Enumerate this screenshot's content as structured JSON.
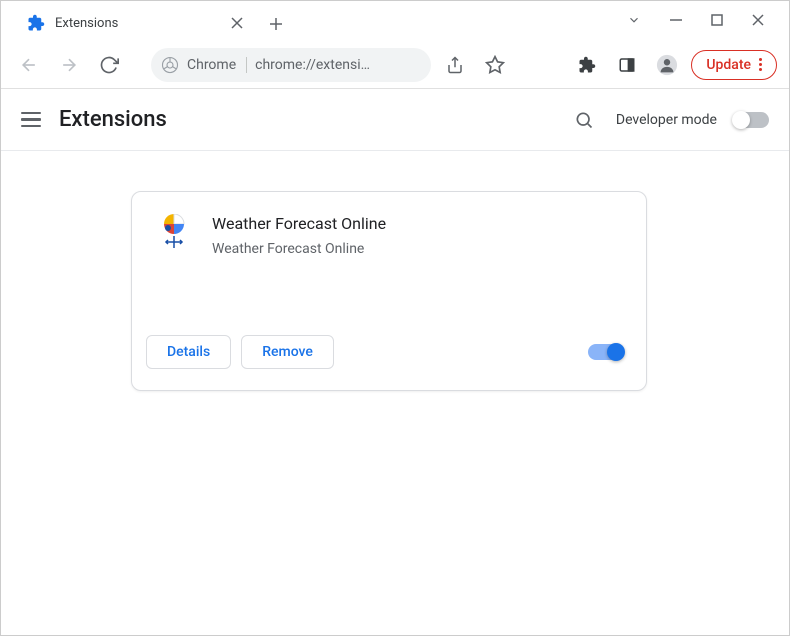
{
  "window": {
    "tab_title": "Extensions",
    "address_scheme": "Chrome",
    "address_url": "chrome://extensi…",
    "update_label": "Update"
  },
  "header": {
    "title": "Extensions",
    "dev_mode_label": "Developer mode",
    "dev_mode_on": false
  },
  "extension": {
    "name": "Weather Forecast Online",
    "description": "Weather Forecast Online",
    "details_label": "Details",
    "remove_label": "Remove",
    "enabled": true
  }
}
